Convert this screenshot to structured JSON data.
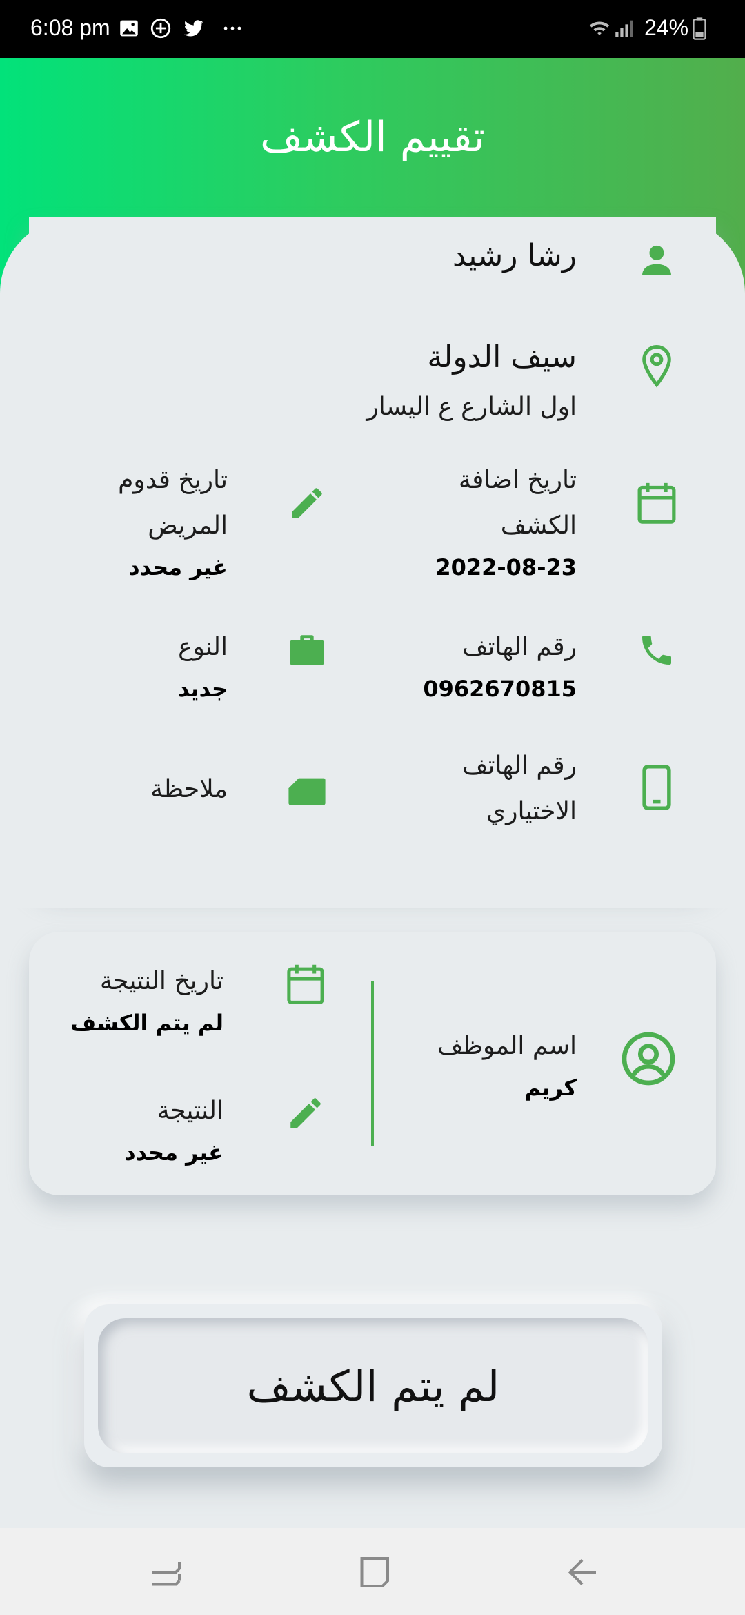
{
  "status_bar": {
    "time": "6:08 pm",
    "battery": "24%",
    "icons": [
      "gallery-icon",
      "plus-circle-icon",
      "twitter-icon",
      "more-dots-icon",
      "wifi-icon",
      "signal-icon",
      "battery-icon"
    ]
  },
  "header": {
    "title": "تقييم الكشف"
  },
  "patient": {
    "name": "رشا رشيد",
    "city": "سيف الدولة",
    "address": "اول الشارع ع اليسار"
  },
  "details": {
    "added_date_label_line1": "تاريخ اضافة",
    "added_date_label_line2": "الكشف",
    "added_date_value": "2022-08-23",
    "arrival_date_label_line1": "تاريخ قدوم",
    "arrival_date_label_line2": "المريض",
    "arrival_date_value": "غير محدد",
    "phone_label": "رقم الهاتف",
    "phone_value": "0962670815",
    "type_label": "النوع",
    "type_value": "جديد",
    "alt_phone_label_line1": "رقم الهاتف",
    "alt_phone_label_line2": "الاختياري",
    "note_label": "ملاحظة"
  },
  "result_card": {
    "employee_label": "اسم الموظف",
    "employee_value": "كريم",
    "result_date_label": "تاريخ النتيجة",
    "result_date_value": "لم يتم الكشف",
    "result_label": "النتيجة",
    "result_value": "غير محدد"
  },
  "action_button": {
    "label": "لم يتم الكشف"
  },
  "colors": {
    "accent": "#4caf50",
    "header_start": "#02e27a",
    "header_end": "#52ae4c",
    "background": "#e8ecee"
  },
  "nav_bar": {
    "buttons": [
      "recent-apps-icon",
      "home-icon",
      "back-icon"
    ]
  }
}
